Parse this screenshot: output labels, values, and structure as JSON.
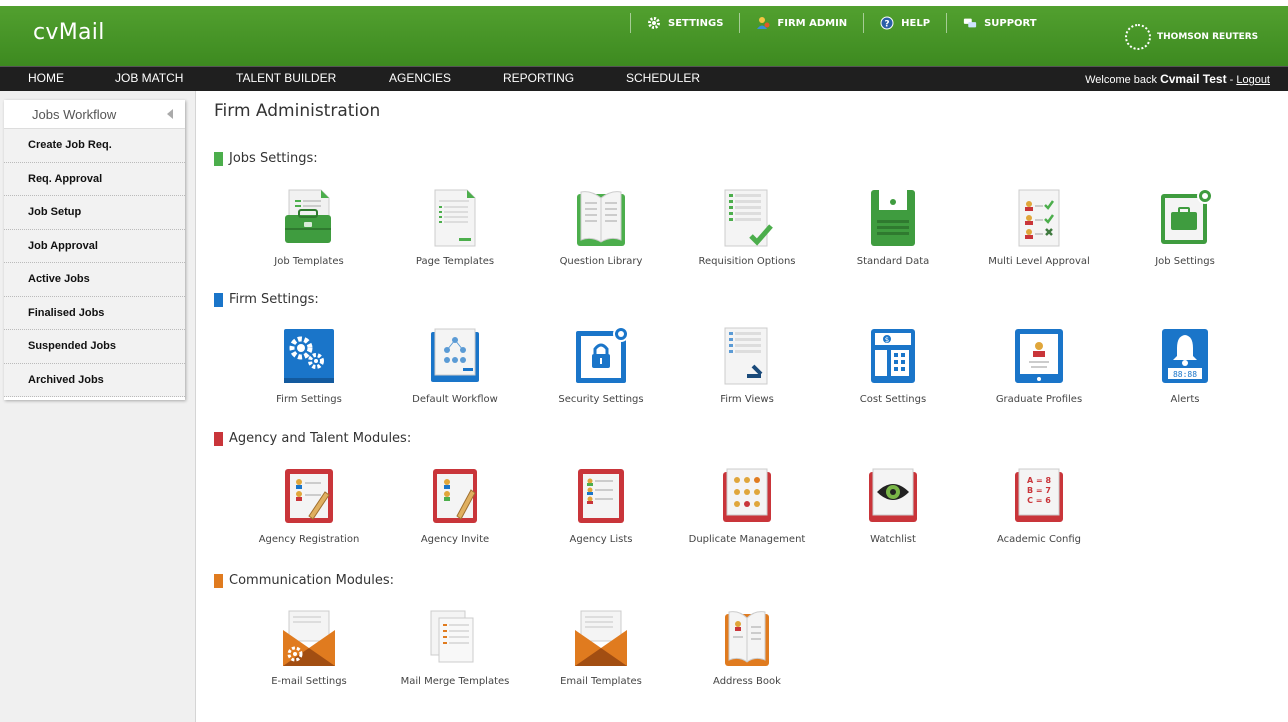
{
  "app": {
    "logo": "cvMail",
    "brand": "THOMSON REUTERS"
  },
  "top_links": [
    {
      "label": "SETTINGS",
      "icon": "gear-icon"
    },
    {
      "label": "FIRM ADMIN",
      "icon": "user-icon"
    },
    {
      "label": "HELP",
      "icon": "help-icon"
    },
    {
      "label": "SUPPORT",
      "icon": "chat-icon"
    }
  ],
  "nav": {
    "items": [
      "HOME",
      "JOB MATCH",
      "TALENT BUILDER",
      "AGENCIES",
      "REPORTING",
      "SCHEDULER"
    ],
    "welcome_prefix": "Welcome back",
    "user": "Cvmail Test",
    "separator": " - ",
    "logout": "Logout"
  },
  "sidebar": {
    "title": "Jobs Workflow",
    "items": [
      "Create Job Req.",
      "Req. Approval",
      "Job Setup",
      "Job Approval",
      "Active Jobs",
      "Finalised Jobs",
      "Suspended Jobs",
      "Archived Jobs"
    ]
  },
  "main": {
    "title": "Firm Administration"
  },
  "sections": [
    {
      "title": "Jobs Settings:",
      "color": "#4cae4c",
      "tiles": [
        {
          "label": "Job Templates",
          "icon": "job-templates-icon"
        },
        {
          "label": "Page Templates",
          "icon": "page-templates-icon"
        },
        {
          "label": "Question Library",
          "icon": "question-library-icon"
        },
        {
          "label": "Requisition Options",
          "icon": "requisition-options-icon"
        },
        {
          "label": "Standard Data",
          "icon": "standard-data-icon"
        },
        {
          "label": "Multi Level Approval",
          "icon": "multi-level-approval-icon"
        },
        {
          "label": "Job Settings",
          "icon": "job-settings-icon"
        }
      ]
    },
    {
      "title": "Firm Settings:",
      "color": "#1a75c9",
      "tiles": [
        {
          "label": "Firm Settings",
          "icon": "firm-settings-icon"
        },
        {
          "label": "Default Workflow",
          "icon": "default-workflow-icon"
        },
        {
          "label": "Security Settings",
          "icon": "security-settings-icon"
        },
        {
          "label": "Firm Views",
          "icon": "firm-views-icon"
        },
        {
          "label": "Cost Settings",
          "icon": "cost-settings-icon"
        },
        {
          "label": "Graduate Profiles",
          "icon": "graduate-profiles-icon"
        },
        {
          "label": "Alerts",
          "icon": "alerts-icon"
        }
      ]
    },
    {
      "title": "Agency and Talent Modules:",
      "color": "#c9353a",
      "tiles": [
        {
          "label": "Agency Registration",
          "icon": "agency-registration-icon"
        },
        {
          "label": "Agency Invite",
          "icon": "agency-invite-icon"
        },
        {
          "label": "Agency Lists",
          "icon": "agency-lists-icon"
        },
        {
          "label": "Duplicate Management",
          "icon": "duplicate-management-icon"
        },
        {
          "label": "Watchlist",
          "icon": "watchlist-icon"
        },
        {
          "label": "Academic Config",
          "icon": "academic-config-icon"
        }
      ]
    },
    {
      "title": "Communication Modules:",
      "color": "#e07b1f",
      "tiles": [
        {
          "label": "E-mail Settings",
          "icon": "email-settings-icon"
        },
        {
          "label": "Mail Merge Templates",
          "icon": "mail-merge-templates-icon"
        },
        {
          "label": "Email Templates",
          "icon": "email-templates-icon"
        },
        {
          "label": "Address Book",
          "icon": "address-book-icon"
        }
      ]
    }
  ],
  "icon_text": {
    "alerts_clock": "88:88",
    "academic": [
      "A = 8",
      "B = 7",
      "C = 6"
    ]
  }
}
